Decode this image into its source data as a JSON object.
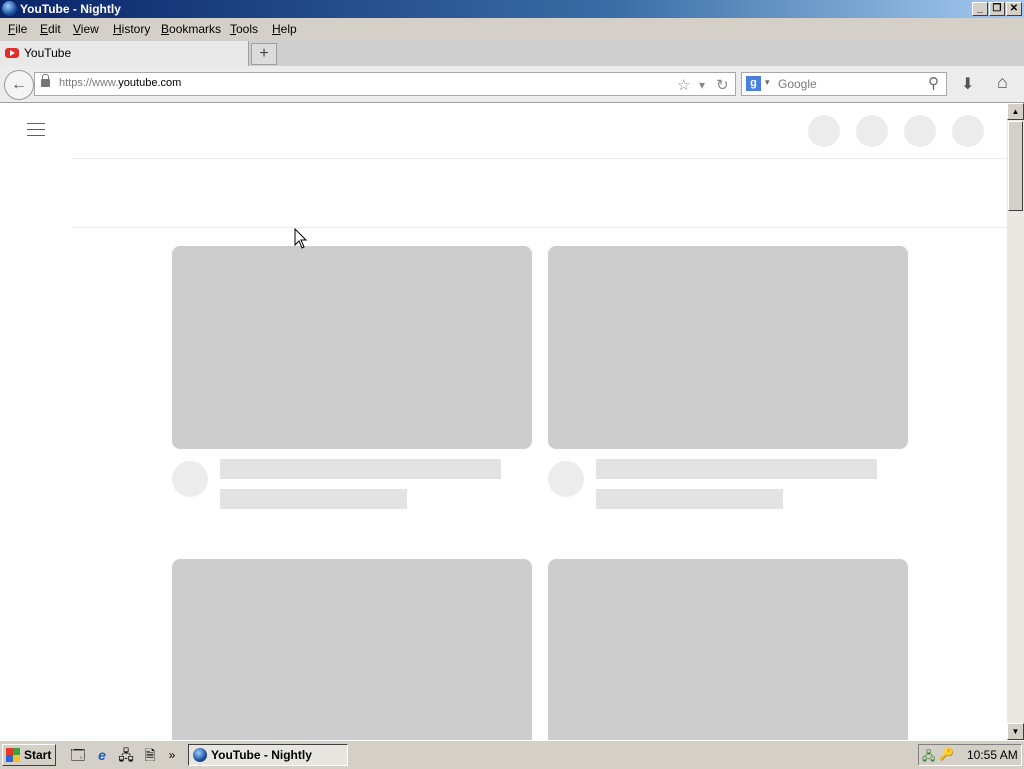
{
  "window": {
    "title": "YouTube - Nightly",
    "controls": [
      "_",
      "❐",
      "✕"
    ]
  },
  "menu": [
    {
      "label": "File",
      "key": "F",
      "rest": "ile"
    },
    {
      "label": "Edit",
      "key": "E",
      "rest": "dit"
    },
    {
      "label": "View",
      "key": "V",
      "rest": "iew"
    },
    {
      "label": "History",
      "key": "H",
      "rest": "istory"
    },
    {
      "label": "Bookmarks",
      "key": "B",
      "rest": "ookmarks"
    },
    {
      "label": "Tools",
      "key": "T",
      "rest": "ools"
    },
    {
      "label": "Help",
      "key": "H",
      "rest": "elp"
    }
  ],
  "tab": {
    "title": "YouTube",
    "new_tab": "+"
  },
  "nav": {
    "back": "←",
    "url_prefix": "https://www.",
    "url_host": "youtube.com",
    "star": "☆",
    "dropdown": "▾",
    "reload": "↻",
    "search_engine": "g",
    "search_caret": "▾",
    "search_placeholder": "Google",
    "search_icon": "⚲",
    "download": "⬇",
    "home": "⌂"
  },
  "scrollbar": {
    "up": "▲",
    "down": "▼"
  },
  "taskbar": {
    "start": "Start",
    "chevron": "»",
    "window": "YouTube - Nightly",
    "clock": "10:55 AM",
    "quicklaunch": [
      "🗔",
      "e",
      "🖧",
      "🗎"
    ],
    "tray": [
      "🖧",
      "🔑"
    ]
  }
}
